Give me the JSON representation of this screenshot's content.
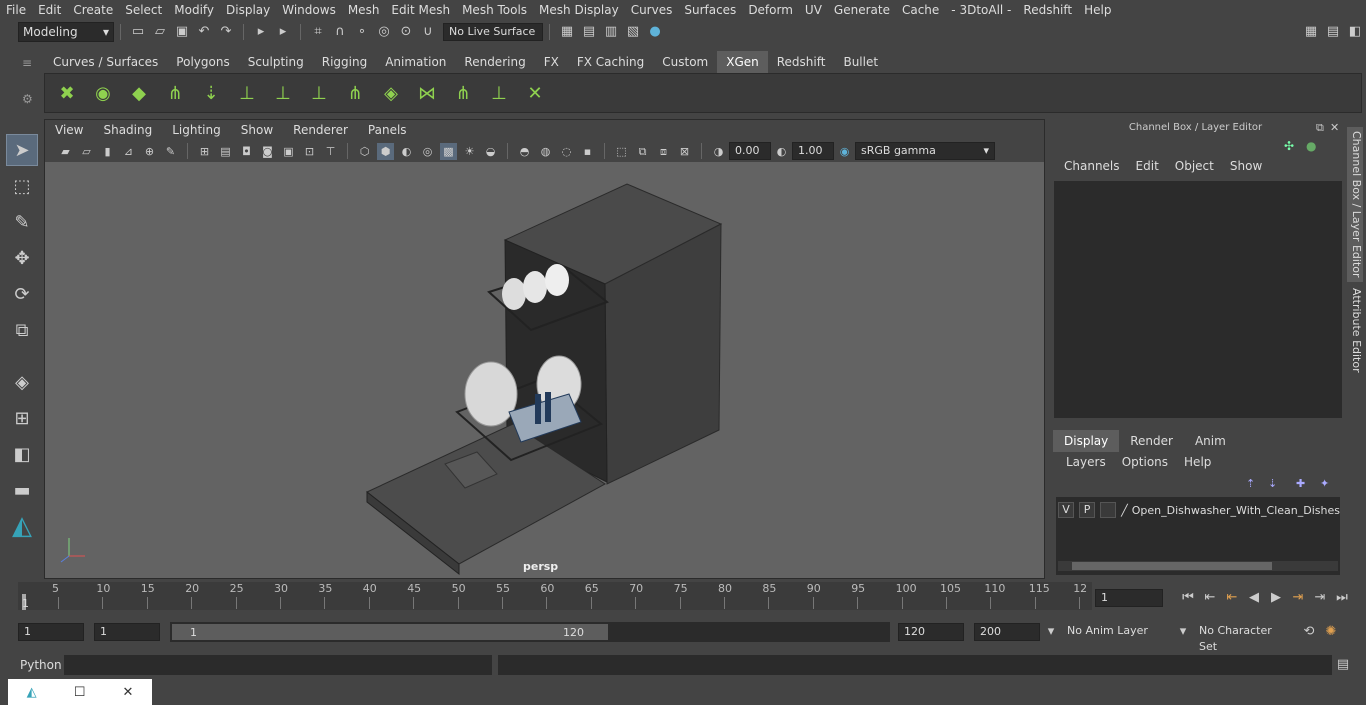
{
  "menus": [
    "File",
    "Edit",
    "Create",
    "Select",
    "Modify",
    "Display",
    "Windows",
    "Mesh",
    "Edit Mesh",
    "Mesh Tools",
    "Mesh Display",
    "Curves",
    "Surfaces",
    "Deform",
    "UV",
    "Generate",
    "Cache",
    "- 3DtoAll -",
    "Redshift",
    "Help"
  ],
  "status": {
    "mode": "Modeling",
    "live_surface": "No Live Surface"
  },
  "shelf_tabs": [
    "Curves / Surfaces",
    "Polygons",
    "Sculpting",
    "Rigging",
    "Animation",
    "Rendering",
    "FX",
    "FX Caching",
    "Custom",
    "XGen",
    "Redshift",
    "Bullet"
  ],
  "active_shelf": "XGen",
  "viewport": {
    "menus": [
      "View",
      "Shading",
      "Lighting",
      "Show",
      "Renderer",
      "Panels"
    ],
    "exposure": "0.00",
    "gamma": "1.00",
    "color_space": "sRGB gamma",
    "camera": "persp"
  },
  "channel_box": {
    "title": "Channel Box / Layer Editor",
    "menus": [
      "Channels",
      "Edit",
      "Object",
      "Show"
    ]
  },
  "layer_editor": {
    "tabs": [
      "Display",
      "Render",
      "Anim"
    ],
    "active_tab": "Display",
    "menus": [
      "Layers",
      "Options",
      "Help"
    ],
    "row": {
      "v": "V",
      "p": "P",
      "name": "Open_Dishwasher_With_Clean_Dishes"
    }
  },
  "side_tabs": [
    "Channel Box / Layer Editor",
    "Attribute Editor"
  ],
  "timeline": {
    "ticks": [
      "5",
      "10",
      "15",
      "20",
      "25",
      "30",
      "35",
      "40",
      "45",
      "50",
      "55",
      "60",
      "65",
      "70",
      "75",
      "80",
      "85",
      "90",
      "95",
      "100",
      "105",
      "110",
      "115",
      "12"
    ],
    "start_label": "1",
    "current_frame": "1"
  },
  "range": {
    "start": "1",
    "current": "1",
    "slider_start": "1",
    "slider_end": "120",
    "end": "120",
    "max": "200",
    "anim_layer": "No Anim Layer",
    "char_set": "No Character Set"
  },
  "cmdline": {
    "label": "Python"
  }
}
